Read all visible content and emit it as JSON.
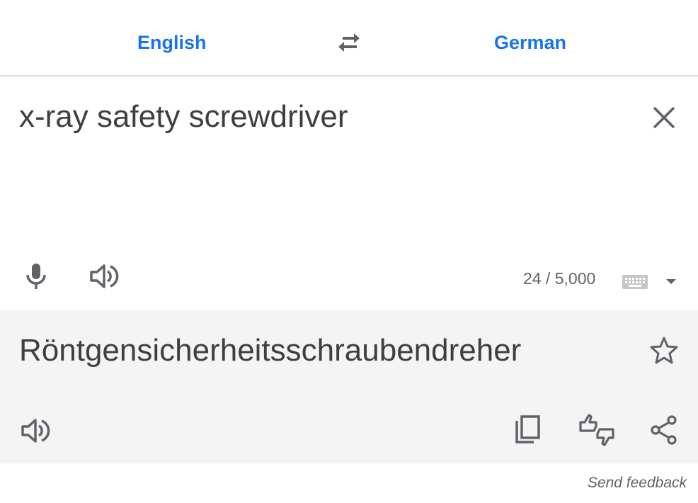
{
  "languages": {
    "source": "English",
    "target": "German"
  },
  "source": {
    "text": "x-ray safety screwdriver",
    "char_count": "24 / 5,000"
  },
  "result": {
    "text": "Röntgensicherheitsschraubendreher"
  },
  "footer": {
    "feedback": "Send feedback"
  },
  "icons": {
    "swap": "swap-arrows-icon",
    "clear": "close-icon",
    "mic": "microphone-icon",
    "speaker": "speaker-icon",
    "keyboard": "keyboard-icon",
    "dropdown": "triangle-down-icon",
    "star": "star-icon",
    "copy": "copy-icon",
    "rate": "thumbs-up-down-icon",
    "share": "share-icon"
  },
  "colors": {
    "accent": "#1a73e8",
    "text": "#3c4043",
    "result_bg": "#f4f4f4",
    "icon": "#5f6368"
  }
}
